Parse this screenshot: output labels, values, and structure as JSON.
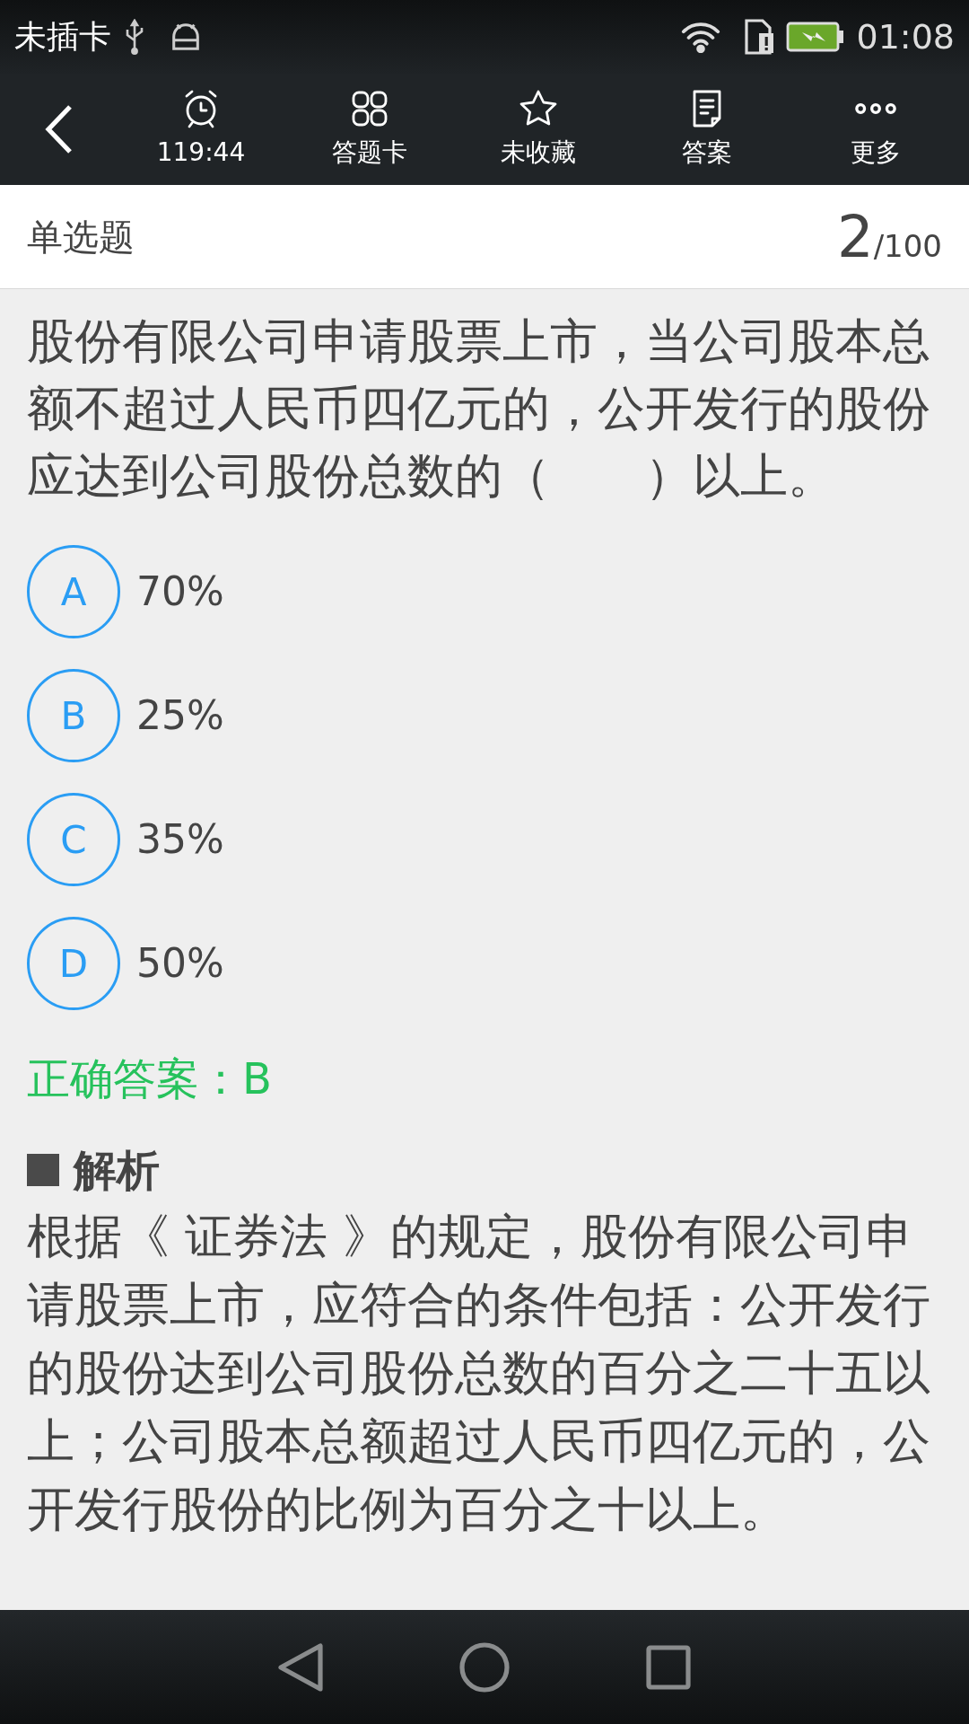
{
  "status_bar": {
    "carrier": "未插卡",
    "time": "01:08"
  },
  "toolbar": {
    "items": [
      {
        "kind": "clock",
        "label": "119:44"
      },
      {
        "kind": "grid",
        "label": "答题卡"
      },
      {
        "kind": "star",
        "label": "未收藏"
      },
      {
        "kind": "document",
        "label": "答案"
      },
      {
        "kind": "more",
        "label": "更多"
      }
    ]
  },
  "header": {
    "type": "单选题",
    "current": "2",
    "total": "/100"
  },
  "question": "股份有限公司申请股票上市，当公司股本总额不超过人民币四亿元的，公开发行的股份应达到公司股份总数的（　　）以上。",
  "options": [
    {
      "letter": "A",
      "text": "70%"
    },
    {
      "letter": "B",
      "text": "25%"
    },
    {
      "letter": "C",
      "text": "35%"
    },
    {
      "letter": "D",
      "text": "50%"
    }
  ],
  "correct_answer": "正确答案：B",
  "analysis": {
    "title": "解析",
    "text": "根据《 证券法 》的规定，股份有限公司申请股票上市，应符合的条件包括：公开发行的股份达到公司股份总数的百分之二十五以上；公司股本总额超过人民币四亿元的，公开发行股份的比例为百分之十以上。"
  }
}
